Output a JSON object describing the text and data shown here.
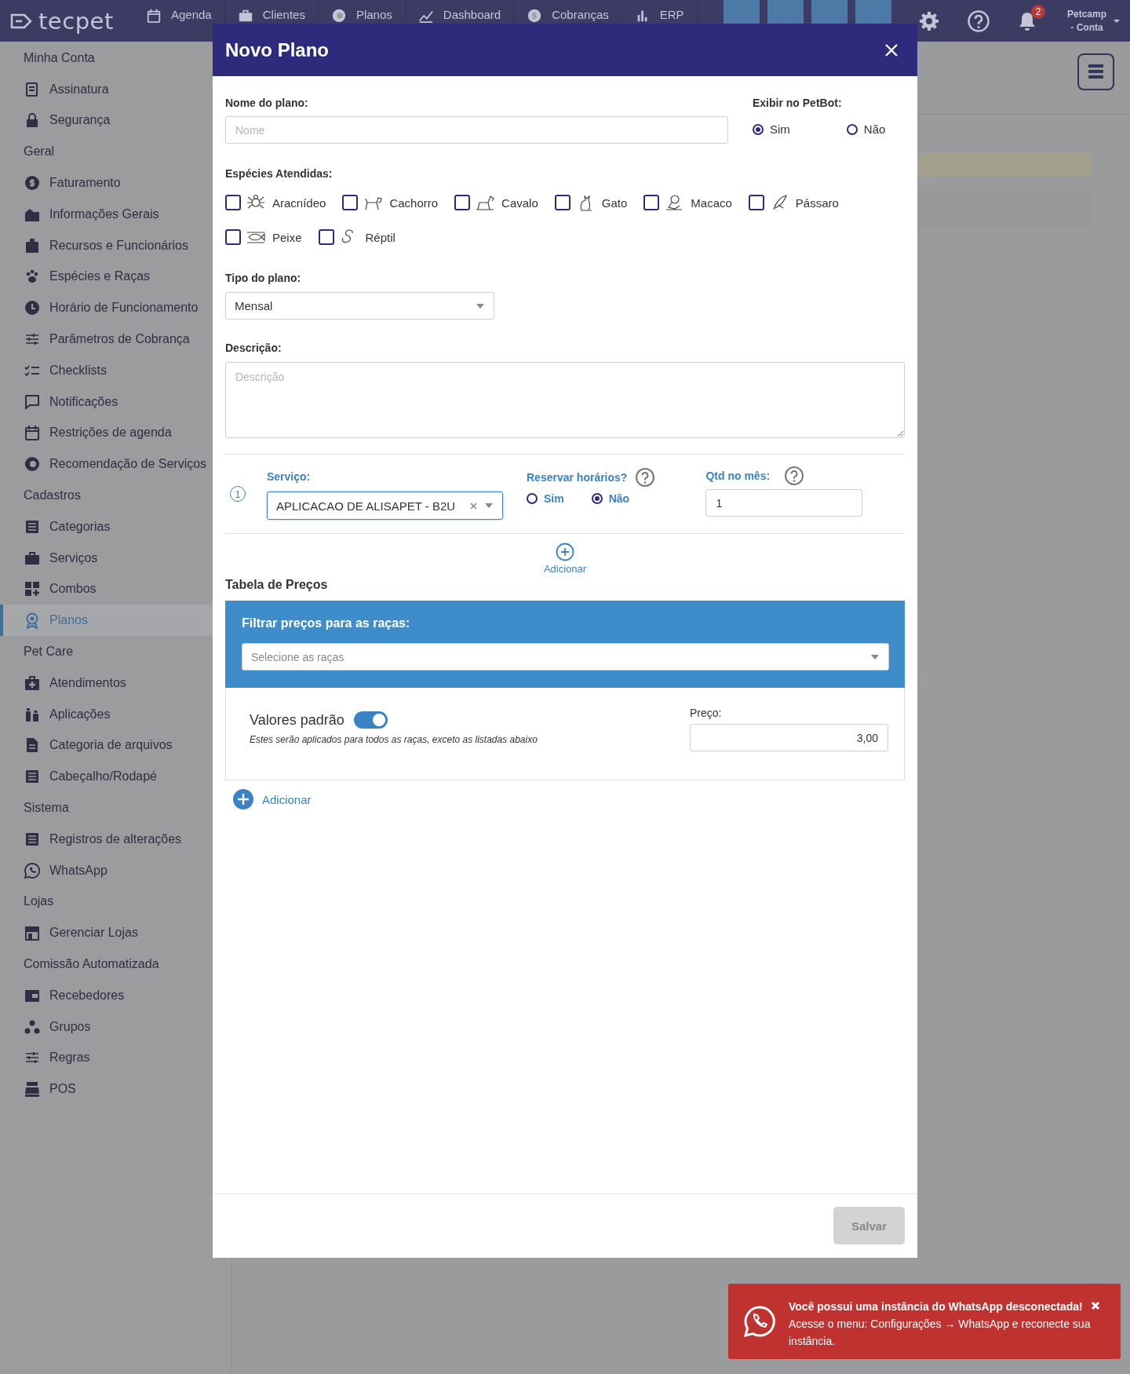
{
  "topbar": {
    "logo": "tecpet",
    "nav": [
      {
        "label": "Agenda"
      },
      {
        "label": "Clientes"
      },
      {
        "label": "Planos"
      },
      {
        "label": "Dashboard"
      },
      {
        "label": "Cobranças"
      },
      {
        "label": "ERP"
      }
    ],
    "notification_count": "2",
    "account": [
      "Petcamp",
      "- Conta"
    ]
  },
  "sidebar": {
    "sections": [
      {
        "title": "Minha Conta",
        "items": [
          {
            "label": "Assinatura",
            "selected": false
          },
          {
            "label": "Segurança",
            "selected": false
          }
        ]
      },
      {
        "title": "Geral",
        "items": [
          {
            "label": "Faturamento",
            "selected": false
          },
          {
            "label": "Informações Gerais",
            "selected": false
          },
          {
            "label": "Recursos e Funcionários",
            "selected": false
          },
          {
            "label": "Espécies e Raças",
            "selected": false
          },
          {
            "label": "Horário de Funcionamento",
            "selected": false
          },
          {
            "label": "Parâmetros de Cobrança",
            "selected": false
          },
          {
            "label": "Checklists",
            "selected": false
          },
          {
            "label": "Notificações",
            "selected": false
          },
          {
            "label": "Restrições de agenda",
            "selected": false
          },
          {
            "label": "Recomendação de Serviços",
            "selected": false
          }
        ]
      },
      {
        "title": "Cadastros",
        "items": [
          {
            "label": "Categorias",
            "selected": false
          },
          {
            "label": "Serviços",
            "selected": false
          },
          {
            "label": "Combos",
            "selected": false
          },
          {
            "label": "Planos",
            "selected": true
          }
        ]
      },
      {
        "title": "Pet Care",
        "items": [
          {
            "label": "Atendimentos",
            "selected": false
          },
          {
            "label": "Aplicações",
            "selected": false
          },
          {
            "label": "Categoria de arquivos",
            "selected": false
          },
          {
            "label": "Cabeçalho/Rodapé",
            "selected": false
          }
        ]
      },
      {
        "title": "Sistema",
        "items": [
          {
            "label": "Registros de alterações",
            "selected": false
          },
          {
            "label": "WhatsApp",
            "selected": false
          }
        ]
      },
      {
        "title": "Lojas",
        "items": [
          {
            "label": "Gerenciar Lojas",
            "selected": false
          }
        ]
      },
      {
        "title": "Comissão Automatizada",
        "items": [
          {
            "label": "Recebedores",
            "selected": false
          },
          {
            "label": "Grupos",
            "selected": false
          },
          {
            "label": "Regras",
            "selected": false
          },
          {
            "label": "POS",
            "selected": false
          }
        ]
      }
    ]
  },
  "modal": {
    "title": "Novo Plano",
    "name_field": {
      "label": "Nome do plano:",
      "placeholder": "Nome"
    },
    "petbot": {
      "label": "Exibir no PetBot:",
      "options": [
        {
          "label": "Sim",
          "selected": true
        },
        {
          "label": "Não",
          "selected": false
        }
      ]
    },
    "species": {
      "label": "Espécies Atendidas:",
      "items": [
        {
          "label": "Aracnídeo",
          "checked": false
        },
        {
          "label": "Cachorro",
          "checked": false
        },
        {
          "label": "Cavalo",
          "checked": false
        },
        {
          "label": "Gato",
          "checked": false
        },
        {
          "label": "Macaco",
          "checked": false
        },
        {
          "label": "Pássaro",
          "checked": false
        },
        {
          "label": "Peixe",
          "checked": false
        },
        {
          "label": "Réptil",
          "checked": false
        }
      ]
    },
    "plan_type": {
      "label": "Tipo do plano:",
      "value": "Mensal"
    },
    "description": {
      "label": "Descrição:",
      "placeholder": "Descrição"
    },
    "services": [
      {
        "index": "1",
        "service_label": "Serviço:",
        "service": "APLICACAO DE ALISAPET - B2U",
        "reserve_label": "Reservar horários?",
        "reserve_options": [
          {
            "label": "Sim",
            "selected": false
          },
          {
            "label": "Não",
            "selected": true
          }
        ],
        "qty_label": "Qtd no mês:",
        "qty": "1"
      }
    ],
    "add_service": "Adicionar",
    "price_table": {
      "title": "Tabela de Preços",
      "filter_label": "Filtrar preços para as raças:",
      "filter_placeholder": "Selecione as raças",
      "default_title": "Valores padrão",
      "default_on": true,
      "default_note": "Estes serão aplicados para todos as raças, exceto as listadas abaixo",
      "price_label": "Preço:",
      "price": "3,00",
      "add": "Adicionar"
    },
    "save": {
      "label": "Salvar",
      "disabled": true
    }
  },
  "toast": {
    "title": "Você possui uma instância do WhatsApp desconectada!",
    "message": "Acesse o menu: Configurações → WhatsApp e reconecte sua instância."
  }
}
